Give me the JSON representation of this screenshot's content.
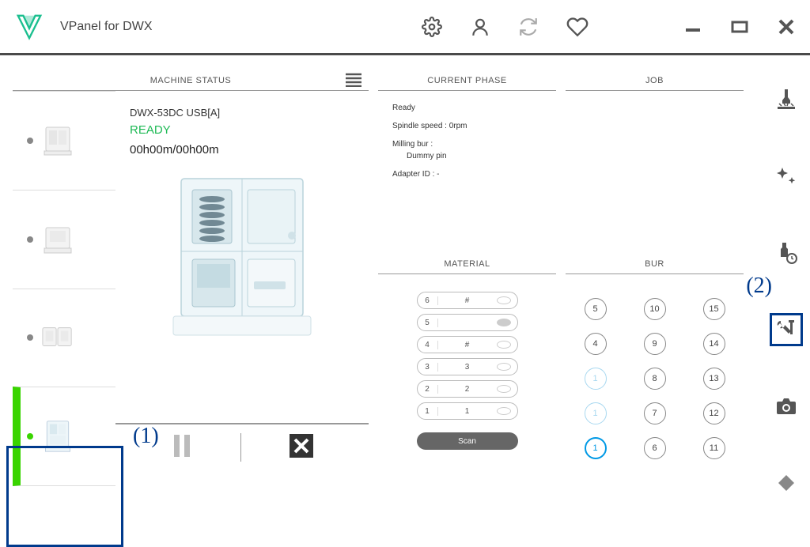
{
  "app": {
    "title": "VPanel for DWX"
  },
  "panels": {
    "machine": {
      "header": "MACHINE STATUS"
    },
    "phase": {
      "header": "CURRENT PHASE"
    },
    "job": {
      "header": "JOB"
    },
    "material": {
      "header": "MATERIAL"
    },
    "bur": {
      "header": "BUR"
    }
  },
  "machine": {
    "name": "DWX-53DC USB[A]",
    "status": "READY",
    "time": "00h00m/00h00m"
  },
  "phase": {
    "ready": "Ready",
    "spindle": "Spindle speed : 0rpm",
    "milling": "Milling bur :",
    "milling_sub": "Dummy pin",
    "adapter": "Adapter ID : -"
  },
  "material": {
    "rows": [
      {
        "idx": "6",
        "val": "#",
        "filled": false
      },
      {
        "idx": "5",
        "val": "",
        "filled": true
      },
      {
        "idx": "4",
        "val": "#",
        "filled": false
      },
      {
        "idx": "3",
        "val": "3",
        "filled": false
      },
      {
        "idx": "2",
        "val": "2",
        "filled": false
      },
      {
        "idx": "1",
        "val": "1",
        "filled": false
      }
    ],
    "scan": "Scan"
  },
  "bur": {
    "cells": [
      {
        "label": "5",
        "style": ""
      },
      {
        "label": "10",
        "style": ""
      },
      {
        "label": "15",
        "style": ""
      },
      {
        "label": "4",
        "style": ""
      },
      {
        "label": "9",
        "style": ""
      },
      {
        "label": "14",
        "style": ""
      },
      {
        "label": "1",
        "style": "light"
      },
      {
        "label": "8",
        "style": ""
      },
      {
        "label": "13",
        "style": ""
      },
      {
        "label": "1",
        "style": "light"
      },
      {
        "label": "7",
        "style": ""
      },
      {
        "label": "12",
        "style": ""
      },
      {
        "label": "1",
        "style": "active"
      },
      {
        "label": "6",
        "style": ""
      },
      {
        "label": "11",
        "style": ""
      }
    ]
  },
  "annotations": {
    "one": "(1)",
    "two": "(2)"
  }
}
